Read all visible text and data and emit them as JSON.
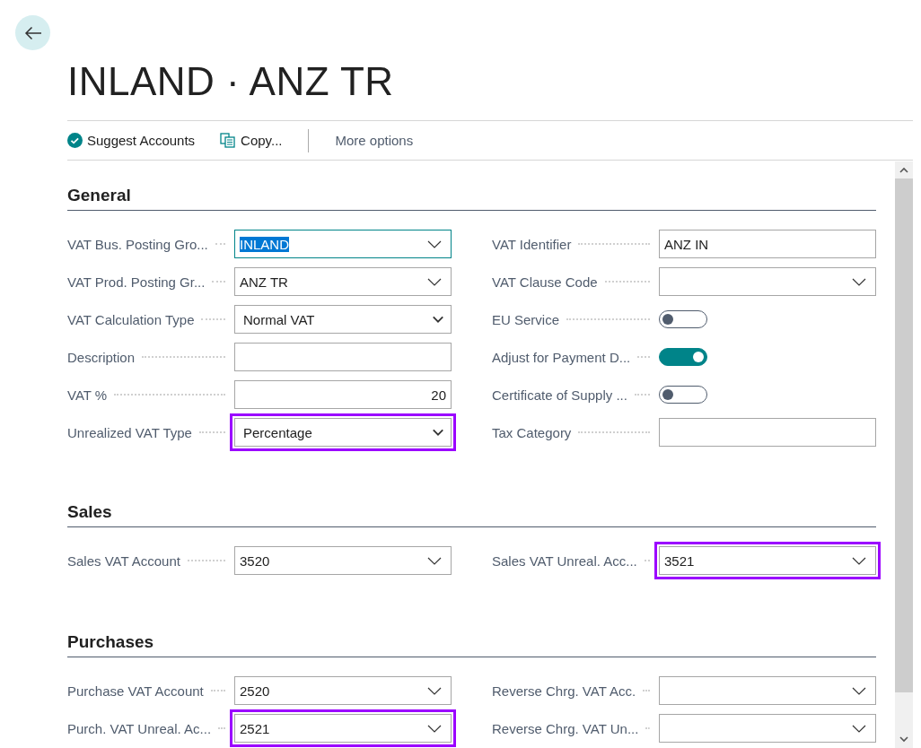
{
  "header": {
    "title": "INLAND · ANZ TR"
  },
  "actions": [
    {
      "kind": "check",
      "label": "Suggest Accounts"
    },
    {
      "kind": "copy",
      "label": "Copy..."
    },
    {
      "kind": "more",
      "label": "More options"
    }
  ],
  "sections": [
    {
      "title": "General",
      "columns": [
        [
          {
            "label": "VAT Bus. Posting Gro...",
            "kind": "lookup",
            "value": "INLAND",
            "focused": true,
            "highlighted": false
          },
          {
            "label": "VAT Prod. Posting Gr...",
            "kind": "lookup",
            "value": "ANZ TR",
            "focused": false,
            "highlighted": false
          },
          {
            "label": "VAT Calculation Type",
            "kind": "select",
            "value": "Normal VAT",
            "focused": false,
            "highlighted": false
          },
          {
            "label": "Description",
            "kind": "text",
            "focused": false,
            "highlighted": false
          },
          {
            "label": "VAT %",
            "kind": "number",
            "value": "20",
            "focused": false,
            "highlighted": false
          },
          {
            "label": "Unrealized VAT Type",
            "kind": "select",
            "value": "Percentage",
            "focused": false,
            "highlighted": true
          }
        ],
        [
          {
            "label": "VAT Identifier",
            "kind": "text",
            "value": "ANZ IN",
            "focused": false,
            "highlighted": false
          },
          {
            "label": "VAT Clause Code",
            "kind": "lookup",
            "focused": false,
            "highlighted": false
          },
          {
            "label": "EU Service",
            "kind": "toggle",
            "on": false
          },
          {
            "label": "Adjust for Payment D...",
            "kind": "toggle",
            "on": true
          },
          {
            "label": "Certificate of Supply ...",
            "kind": "toggle",
            "on": false
          },
          {
            "label": "Tax Category",
            "kind": "text",
            "focused": false,
            "highlighted": false
          }
        ]
      ]
    },
    {
      "title": "Sales",
      "columns": [
        [
          {
            "label": "Sales VAT Account",
            "kind": "lookup",
            "value": "3520",
            "focused": false,
            "highlighted": false
          }
        ],
        [
          {
            "label": "Sales VAT Unreal. Acc...",
            "kind": "lookup",
            "value": "3521",
            "focused": false,
            "highlighted": true
          }
        ]
      ]
    },
    {
      "title": "Purchases",
      "columns": [
        [
          {
            "label": "Purchase VAT Account",
            "kind": "lookup",
            "value": "2520",
            "focused": false,
            "highlighted": false
          },
          {
            "label": "Purch. VAT Unreal. Ac...",
            "kind": "lookup",
            "value": "2521",
            "focused": false,
            "highlighted": true
          }
        ],
        [
          {
            "label": "Reverse Chrg. VAT Acc.",
            "kind": "lookup",
            "focused": false,
            "highlighted": false
          },
          {
            "label": "Reverse Chrg. VAT Un...",
            "kind": "lookup",
            "focused": false,
            "highlighted": false
          }
        ]
      ]
    }
  ]
}
